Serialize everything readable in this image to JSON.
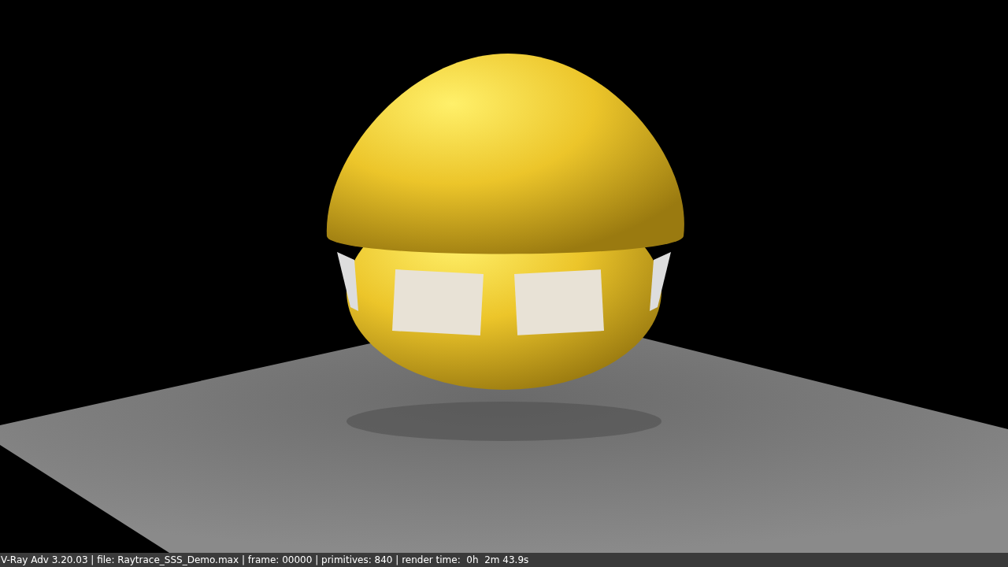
{
  "render_view": {
    "status_bar": "V-Ray Adv 3.20.03 | file: Raytrace_SSS_Demo.max | frame: 00000 | primitives: 840 | render time:  0h  2m 43.9s"
  }
}
